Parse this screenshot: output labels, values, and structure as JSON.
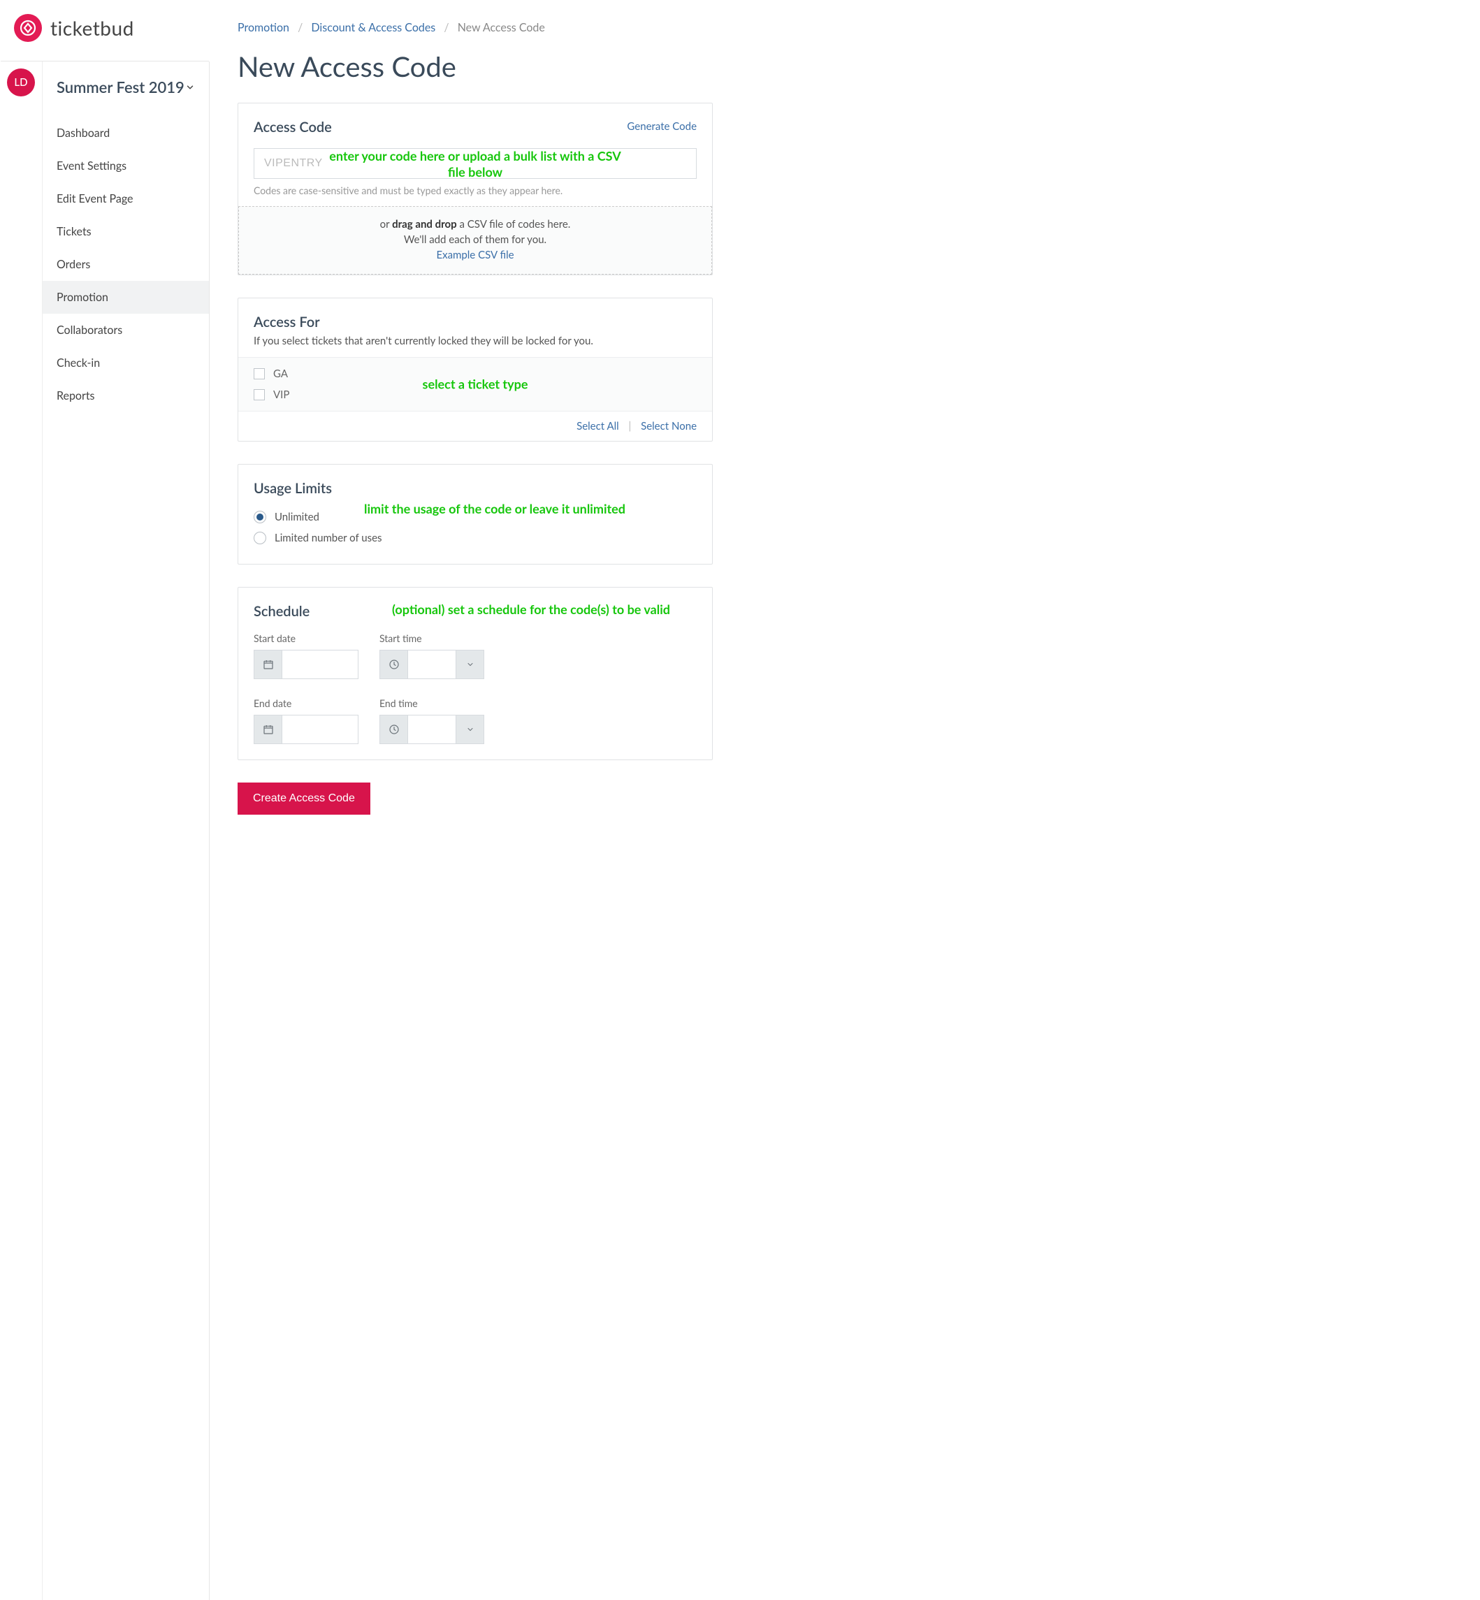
{
  "brand": {
    "name": "ticketbud"
  },
  "avatar": {
    "initials": "LD"
  },
  "event": {
    "title": "Summer Fest 2019"
  },
  "sidebar": {
    "items": [
      {
        "label": "Dashboard"
      },
      {
        "label": "Event Settings"
      },
      {
        "label": "Edit Event Page"
      },
      {
        "label": "Tickets"
      },
      {
        "label": "Orders"
      },
      {
        "label": "Promotion"
      },
      {
        "label": "Collaborators"
      },
      {
        "label": "Check-in"
      },
      {
        "label": "Reports"
      }
    ],
    "active_index": 5
  },
  "breadcrumbs": {
    "a": "Promotion",
    "b": "Discount & Access Codes",
    "current": "New Access Code"
  },
  "page": {
    "title": "New Access Code"
  },
  "access_code": {
    "title": "Access Code",
    "generate": "Generate Code",
    "placeholder": "VIPENTRY",
    "helper": "Codes are case-sensitive and must be typed exactly as they appear here.",
    "drop_prefix": "or ",
    "drop_bold": "drag and drop",
    "drop_suffix": " a CSV file of codes here.",
    "drop_line2": "We'll add each of them for you.",
    "example_link": "Example CSV file"
  },
  "access_for": {
    "title": "Access For",
    "sub": "If you select tickets that aren't currently locked they will be locked for you.",
    "tickets": [
      {
        "label": "GA"
      },
      {
        "label": "VIP"
      }
    ],
    "select_all": "Select All",
    "select_none": "Select None"
  },
  "usage": {
    "title": "Usage Limits",
    "options": [
      {
        "label": "Unlimited",
        "checked": true
      },
      {
        "label": "Limited number of uses",
        "checked": false
      }
    ]
  },
  "schedule": {
    "title": "Schedule",
    "start_date_label": "Start date",
    "start_time_label": "Start time",
    "end_date_label": "End date",
    "end_time_label": "End time"
  },
  "submit": {
    "label": "Create Access Code"
  },
  "annotations": {
    "code": "enter your code here or upload a bulk list with a CSV file below",
    "ticket": "select a ticket type",
    "usage": "limit the usage of the code or leave it unlimited",
    "schedule": "(optional) set a schedule for the code(s) to be valid"
  }
}
